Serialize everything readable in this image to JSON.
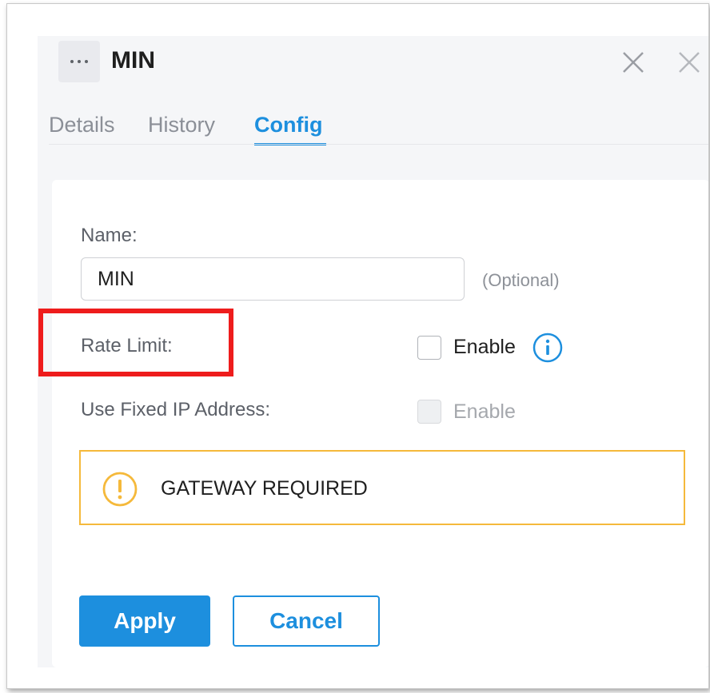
{
  "panel": {
    "title": "MIN",
    "more_icon": "more-dots-icon",
    "close_icon": "close-icon"
  },
  "tabs": [
    {
      "label": "Details",
      "active": false
    },
    {
      "label": "History",
      "active": false
    },
    {
      "label": "Config",
      "active": true
    }
  ],
  "form": {
    "name_label": "Name:",
    "name_value": "MIN",
    "name_hint": "(Optional)",
    "rate_limit_label": "Rate Limit:",
    "rate_limit_enable_label": "Enable",
    "rate_limit_checked": false,
    "fixed_ip_label": "Use Fixed IP Address:",
    "fixed_ip_enable_label": "Enable",
    "fixed_ip_checked": false,
    "fixed_ip_disabled": true
  },
  "warning": {
    "text": "GATEWAY REQUIRED",
    "icon": "warning-icon"
  },
  "buttons": {
    "apply": "Apply",
    "cancel": "Cancel"
  },
  "colors": {
    "accent": "#1d8fde",
    "warning_border": "#f5b93b",
    "highlight": "#ee1c1c"
  }
}
